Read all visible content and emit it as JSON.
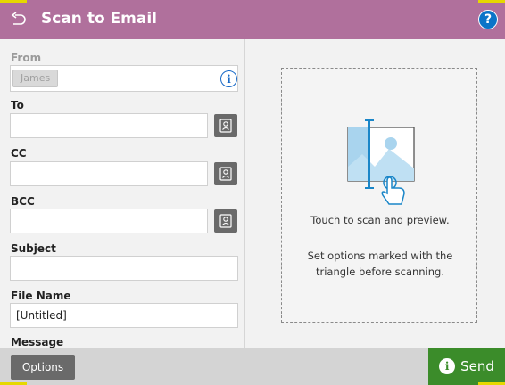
{
  "header": {
    "title": "Scan to Email",
    "help_label": "?"
  },
  "form": {
    "from": {
      "label": "From",
      "chip": "James",
      "info_glyph": "i"
    },
    "to": {
      "label": "To",
      "value": ""
    },
    "cc": {
      "label": "CC",
      "value": ""
    },
    "bcc": {
      "label": "BCC",
      "value": ""
    },
    "subject": {
      "label": "Subject",
      "value": ""
    },
    "file_name": {
      "label": "File Name",
      "value": "[Untitled]"
    },
    "message": {
      "label": "Message"
    }
  },
  "preview": {
    "touch_text": "Touch to scan and preview.",
    "options_hint": "Set options marked with the triangle before scanning."
  },
  "footer": {
    "options_label": "Options",
    "send_label": "Send",
    "send_info_glyph": "i"
  },
  "colors": {
    "header": "#b0709c",
    "accent": "#e6d800",
    "send": "#3b8c2a",
    "info": "#1769c7"
  }
}
